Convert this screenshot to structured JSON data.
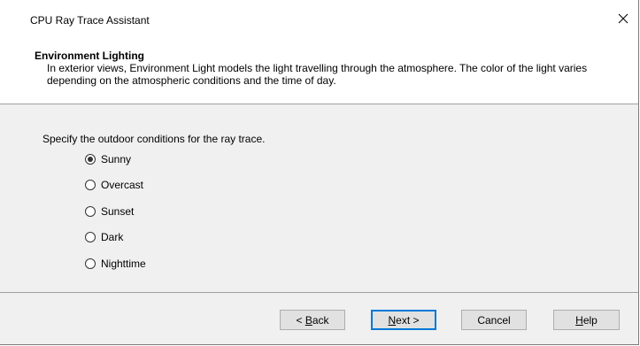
{
  "window": {
    "title": "CPU Ray Trace Assistant",
    "close_icon": "close-icon"
  },
  "header": {
    "title": "Environment Lighting",
    "description": "In exterior views, Environment Light models the light travelling through the atmosphere. The color of the light varies depending on the atmospheric conditions and the time of day."
  },
  "content": {
    "prompt": "Specify the outdoor conditions for the ray trace.",
    "options": [
      {
        "label": "Sunny",
        "checked": true
      },
      {
        "label": "Overcast",
        "checked": false
      },
      {
        "label": "Sunset",
        "checked": false
      },
      {
        "label": "Dark",
        "checked": false
      },
      {
        "label": "Nighttime",
        "checked": false
      }
    ]
  },
  "footer": {
    "back_prefix": "< ",
    "back_mnemonic": "B",
    "back_rest": "ack",
    "next_mnemonic": "N",
    "next_rest": "ext >",
    "cancel_label": "Cancel",
    "help_mnemonic": "H",
    "help_rest": "elp"
  },
  "colors": {
    "accent": "#0078d7",
    "panel": "#f0f0f0",
    "button": "#e1e1e1"
  }
}
